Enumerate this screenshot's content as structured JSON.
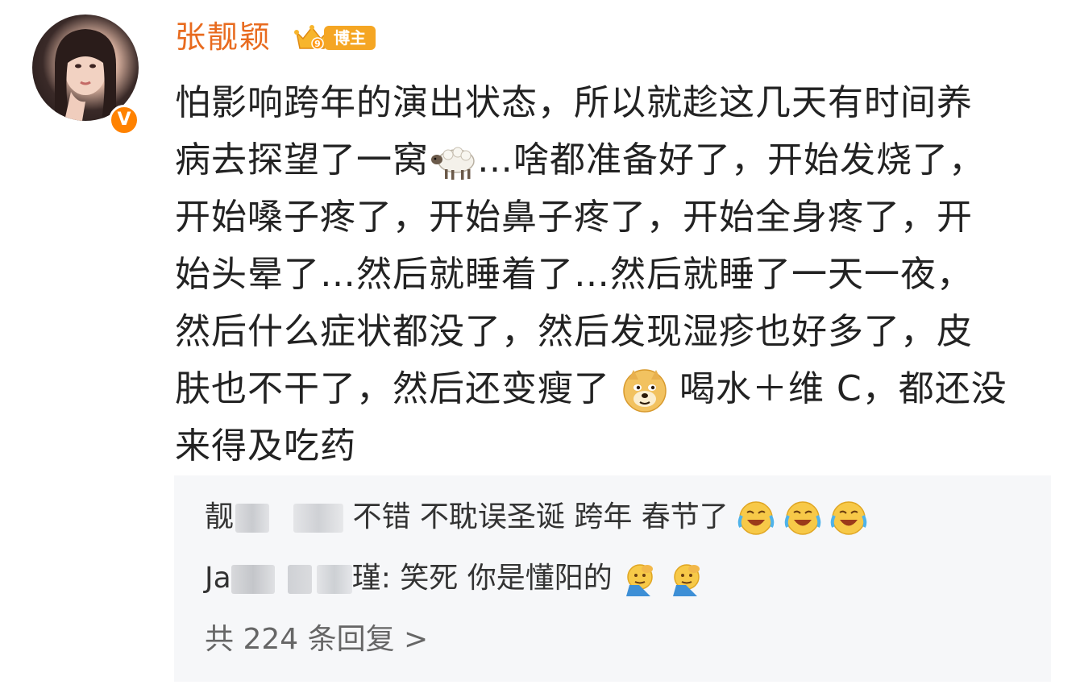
{
  "user": {
    "name": "张靓颖",
    "badge_label": "博主",
    "verified_glyph": "V"
  },
  "post": {
    "lines": [
      "怕影响跨年的演出状态，所以就趁这几天有时间养",
      "病去探望了一窝",
      "…啥都准备好了，开始发烧了，",
      "开始嗓子疼了，开始鼻子疼了，开始全身疼了，开",
      "始头晕了…然后就睡着了…然后就睡了一天一夜，",
      "然后什么症状都没了，然后发现湿疹也好多了，皮",
      "肤也不干了，然后还变瘦了",
      "喝水＋维 C，都还没",
      "来得及吃药"
    ],
    "emojis": [
      "sheep-icon",
      "doge-icon"
    ]
  },
  "comments": {
    "items": [
      {
        "author_visible": "靓",
        "text": "不错 不耽误圣诞 跨年 春节了",
        "emojis": [
          "laugh-cry-icon",
          "laugh-cry-icon",
          "laugh-cry-icon"
        ]
      },
      {
        "author_visible": "Ja",
        "author_tail": "瑾:",
        "text": "笑死 你是懂阳的",
        "emojis": [
          "facepalm-icon",
          "facepalm-icon"
        ]
      }
    ],
    "reply_count": "共 224 条回复 >"
  },
  "colors": {
    "username": "#e86b1f",
    "verified_badge": "#ff8200",
    "blogger_tag": "#f5a623",
    "comment_bg": "#f6f7f9"
  }
}
